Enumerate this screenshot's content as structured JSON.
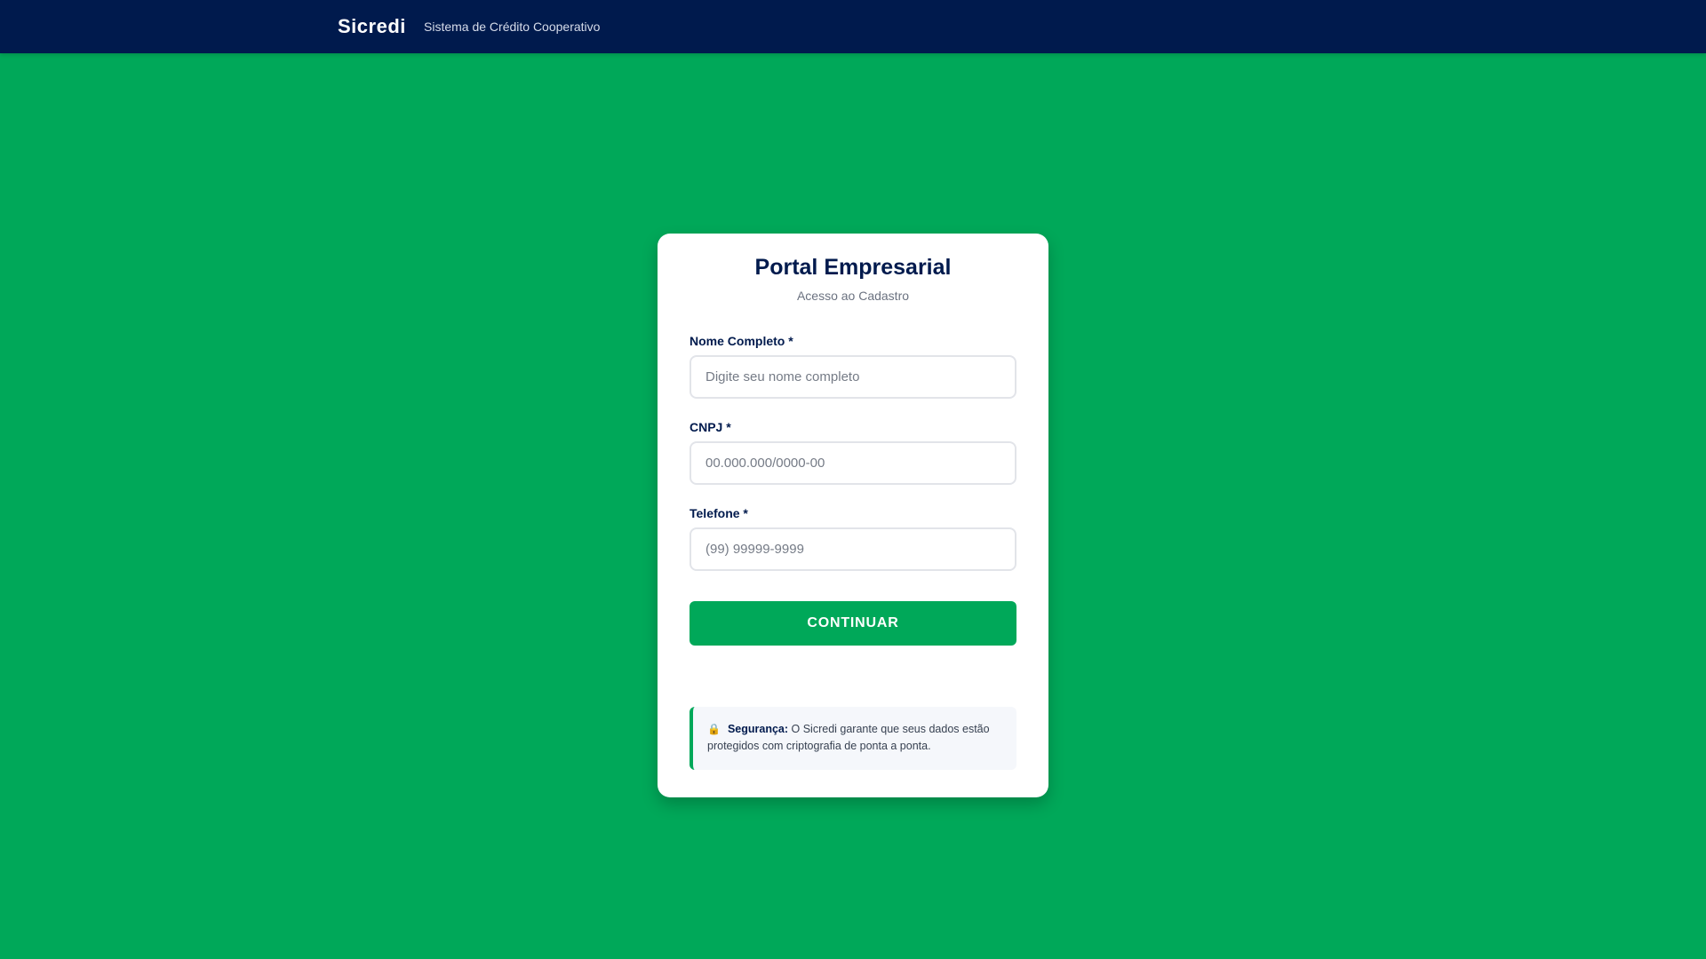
{
  "header": {
    "brand": "Sicredi",
    "tagline": "Sistema de Crédito Cooperativo"
  },
  "card": {
    "title": "Portal Empresarial",
    "subtitle": "Acesso ao Cadastro"
  },
  "form": {
    "name": {
      "label": "Nome Completo *",
      "placeholder": "Digite seu nome completo",
      "value": ""
    },
    "cnpj": {
      "label": "CNPJ *",
      "placeholder": "00.000.000/0000-00",
      "value": ""
    },
    "phone": {
      "label": "Telefone *",
      "placeholder": "(99) 99999-9999",
      "value": ""
    },
    "submit_label": "CONTINUAR"
  },
  "security": {
    "icon": "lock-icon",
    "icon_glyph": "🔒",
    "title": "Segurança:",
    "text": " O Sicredi garante que seus dados estão protegidos com criptografia de ponta a ponta."
  },
  "colors": {
    "header_bg": "#001a4d",
    "page_bg": "#00a859",
    "accent": "#00a859",
    "title": "#001a4d"
  }
}
